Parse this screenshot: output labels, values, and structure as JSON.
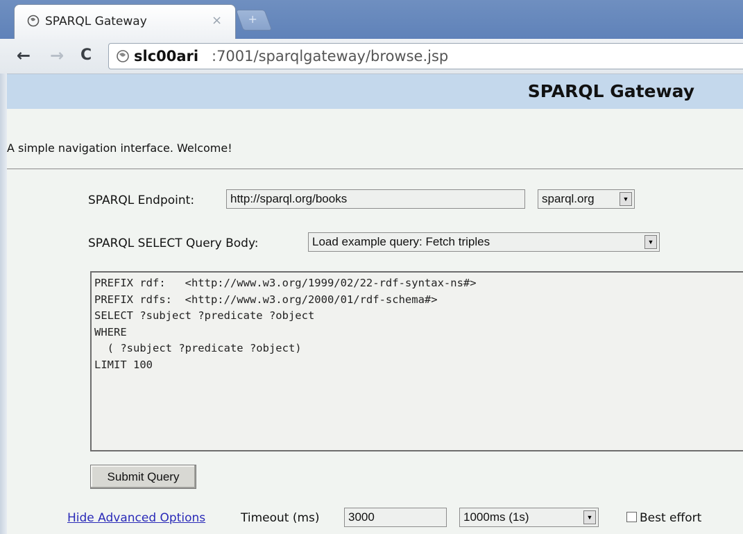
{
  "browser": {
    "tab_title": "SPARQL Gateway",
    "tab_close": "×",
    "new_tab_symbol": "+",
    "back": "←",
    "forward": "→",
    "reload": "C",
    "url_host": "slc00ari",
    "url_rest": ":7001/sparqlgateway/browse.jsp"
  },
  "page": {
    "banner_title": "SPARQL Gateway",
    "welcome": "A simple navigation interface. Welcome!",
    "endpoint_label": "SPARQL Endpoint:",
    "endpoint_value": "http://sparql.org/books",
    "endpoint_select": "sparql.org",
    "query_label": "SPARQL SELECT Query Body:",
    "query_select": "Load example query: Fetch triples",
    "query_lines": [
      "PREFIX rdf:   <http://www.w3.org/1999/02/22-rdf-syntax-ns#>",
      "PREFIX rdfs:  <http://www.w3.org/2000/01/rdf-schema#>",
      "SELECT ?subject ?predicate ?object",
      "WHERE",
      "  ( ?subject ?predicate ?object)",
      "LIMIT 100"
    ],
    "submit_label": "Submit Query",
    "advanced_link": "Hide Advanced Options",
    "timeout_label": "Timeout (ms)",
    "timeout_value": "3000",
    "timeout_select": "1000ms (1s)",
    "best_effort_label": "Best effort"
  },
  "colors": {
    "banner": "#c4d8ec",
    "page_bg": "#f1f4f1",
    "link": "#2a2ab8"
  }
}
